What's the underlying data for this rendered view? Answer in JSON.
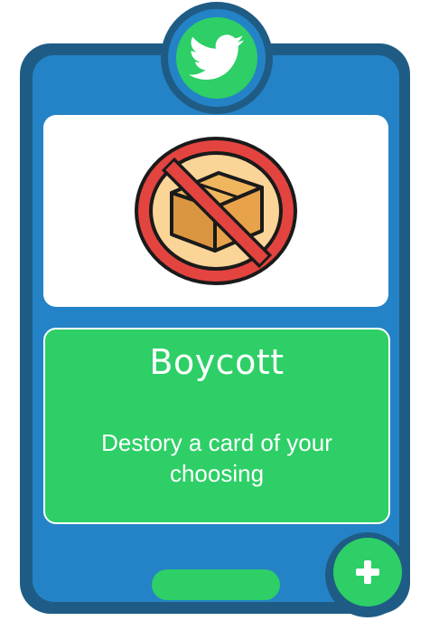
{
  "card": {
    "title": "Boycott",
    "description": "Destory a card of your choosing",
    "top_icon": "twitter-bird-icon",
    "image_icon": "no-box-icon",
    "plus_icon": "plus-icon"
  },
  "colors": {
    "frame_dark": "#1f5c85",
    "frame_blue": "#2483c6",
    "accent_green": "#2dcf66",
    "ban_red": "#e3443f",
    "box_orange": "#e8a24a",
    "circle_peach": "#fbd597"
  }
}
